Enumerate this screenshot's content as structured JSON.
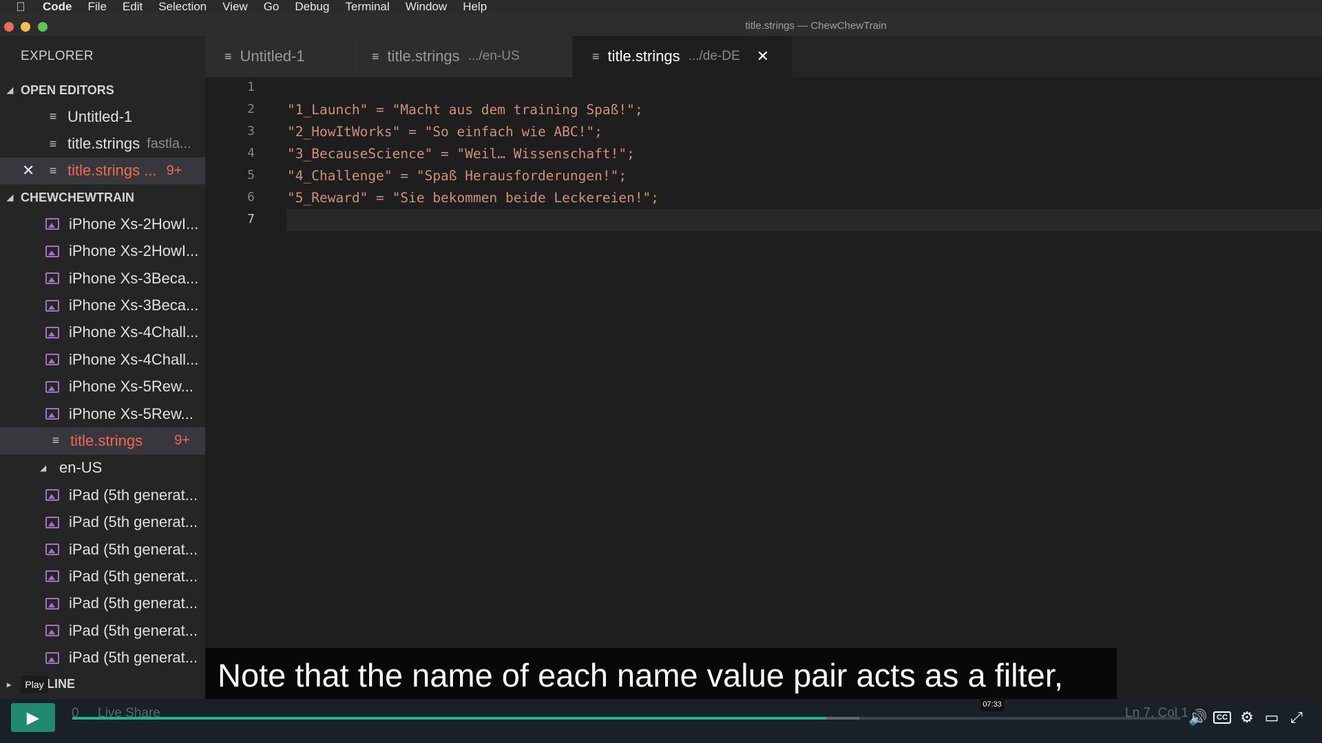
{
  "menubar": {
    "items": [
      "Code",
      "File",
      "Edit",
      "Selection",
      "View",
      "Go",
      "Debug",
      "Terminal",
      "Window",
      "Help"
    ]
  },
  "window": {
    "title": "title.strings — ChewChewTrain"
  },
  "sidebar": {
    "header": "EXPLORER",
    "open_editors": {
      "title": "OPEN EDITORS",
      "items": [
        {
          "name": "Untitled-1",
          "hint": "",
          "badge": ""
        },
        {
          "name": "title.strings",
          "hint": "fastla...",
          "badge": ""
        },
        {
          "name": "title.strings ...",
          "hint": "",
          "badge": "9+"
        }
      ]
    },
    "project": {
      "title": "CHEWCHEWTRAIN",
      "items": [
        "iPhone Xs-2HowI...",
        "iPhone Xs-2HowI...",
        "iPhone Xs-3Beca...",
        "iPhone Xs-3Beca...",
        "iPhone Xs-4Chall...",
        "iPhone Xs-4Chall...",
        "iPhone Xs-5Rew...",
        "iPhone Xs-5Rew..."
      ],
      "active_file": {
        "name": "title.strings",
        "badge": "9+"
      },
      "folder": "en-US",
      "folder_items": [
        "iPad (5th generat...",
        "iPad (5th generat...",
        "iPad (5th generat...",
        "iPad (5th generat...",
        "iPad (5th generat...",
        "iPad (5th generat...",
        "iPad (5th generat..."
      ]
    },
    "outline": "OUTLINE"
  },
  "tabs": [
    {
      "name": "Untitled-1",
      "path": ""
    },
    {
      "name": "title.strings",
      "path": ".../en-US"
    },
    {
      "name": "title.strings",
      "path": ".../de-DE"
    }
  ],
  "editor": {
    "lines": [
      {
        "num": "1",
        "text": ""
      },
      {
        "num": "2",
        "text": "\"1_Launch\" = \"Macht aus dem training Spaß!\";"
      },
      {
        "num": "3",
        "text": "\"2_HowItWorks\" = \"So einfach wie ABC!\";"
      },
      {
        "num": "4",
        "text": "\"3_BecauseScience\" = \"Weil… Wissenschaft!\";"
      },
      {
        "num": "5",
        "text": "\"4_Challenge\" = \"Spaß Herausforderungen!\";"
      },
      {
        "num": "6",
        "text": "\"5_Reward\" = \"Sie bekommen beide Leckereien!\";"
      },
      {
        "num": "7",
        "text": ""
      }
    ]
  },
  "caption": "Note that the name of each name value pair acts as a filter,",
  "video": {
    "play_tooltip": "Play",
    "time": "07:33",
    "progress_fraction": 0.68,
    "buffered_fraction": 0.71,
    "status_left": "0",
    "status_liveshare": "Live Share",
    "status_right": "Ln 7, Col 1"
  },
  "colors": {
    "accent_progress": "#1fb58f",
    "modified_file": "#f1694f",
    "string": "#ce9178"
  }
}
